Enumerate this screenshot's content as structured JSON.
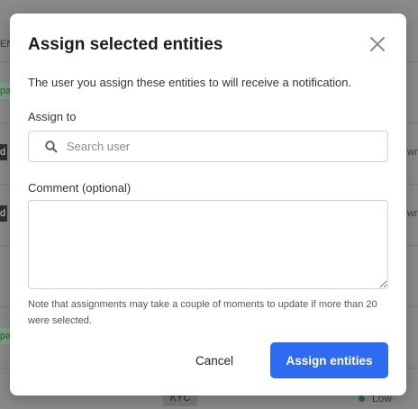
{
  "background": {
    "left_chips": [
      "EN",
      "pa",
      "d",
      "d",
      "pa"
    ],
    "right_chips": [
      "wn",
      "wn"
    ],
    "kyc_label": "KYC",
    "low_label": "Low"
  },
  "modal": {
    "title": "Assign selected entities",
    "close_icon": "close-icon",
    "description": "The user you assign these entities to will receive a notification.",
    "assign_to_label": "Assign to",
    "search": {
      "placeholder": "Search user",
      "value": "",
      "icon": "search-icon"
    },
    "comment_label": "Comment (optional)",
    "comment_value": "",
    "note": "Note that assignments may take a couple of moments to update if more than 20 were selected.",
    "cancel_label": "Cancel",
    "submit_label": "Assign entities"
  },
  "colors": {
    "accent": "#2f6bf0",
    "backdrop": "#8a8a8a"
  }
}
